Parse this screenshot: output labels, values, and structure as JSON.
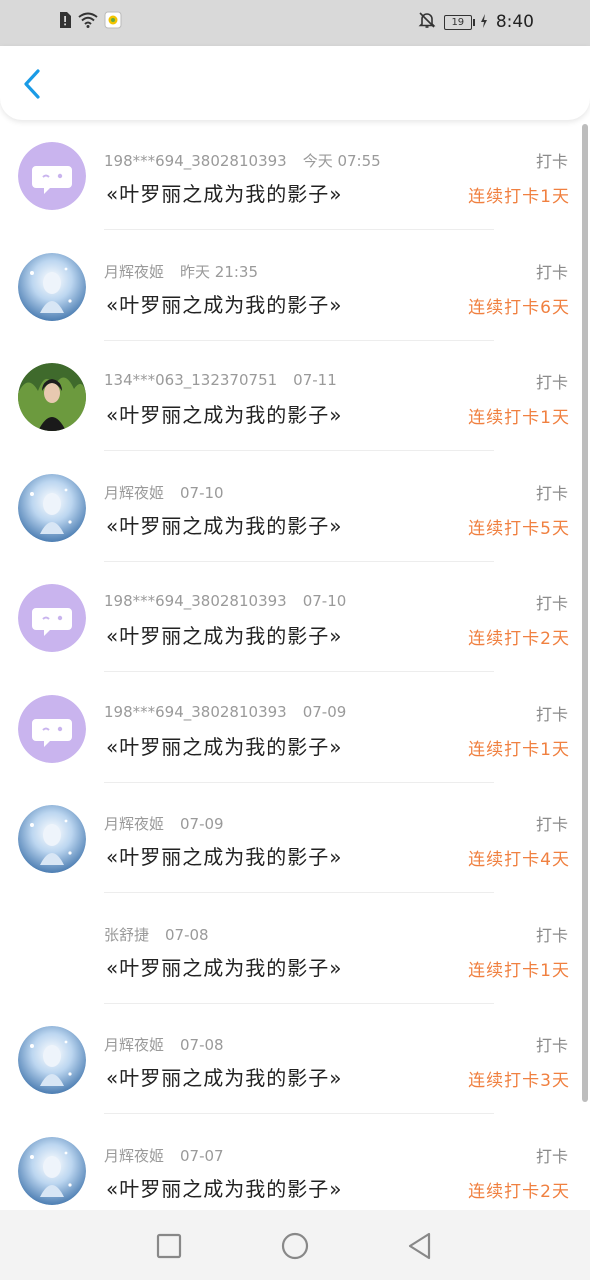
{
  "status_bar": {
    "time": "8:40",
    "battery_level": "19"
  },
  "icons": {
    "back": "chevron-left-icon",
    "nav_recent": "square-icon",
    "nav_home": "circle-icon",
    "nav_back": "triangle-back-icon"
  },
  "colors": {
    "accent_blue": "#1a9be6",
    "streak_orange": "#f08040",
    "avatar_purple": "#c9b4ee"
  },
  "list": [
    {
      "user": "198***694_3802810393",
      "date": "今天 07:55",
      "title": "«叶罗丽之成为我的影子»",
      "action": "打卡",
      "streak": "连续打卡1天",
      "avatar": "purple"
    },
    {
      "user": "月辉夜姬",
      "date": "昨天 21:35",
      "title": "«叶罗丽之成为我的影子»",
      "action": "打卡",
      "streak": "连续打卡6天",
      "avatar": "blue"
    },
    {
      "user": "134***063_132370751",
      "date": "07-11",
      "title": "«叶罗丽之成为我的影子»",
      "action": "打卡",
      "streak": "连续打卡1天",
      "avatar": "green"
    },
    {
      "user": "月辉夜姬",
      "date": "07-10",
      "title": "«叶罗丽之成为我的影子»",
      "action": "打卡",
      "streak": "连续打卡5天",
      "avatar": "blue"
    },
    {
      "user": "198***694_3802810393",
      "date": "07-10",
      "title": "«叶罗丽之成为我的影子»",
      "action": "打卡",
      "streak": "连续打卡2天",
      "avatar": "purple"
    },
    {
      "user": "198***694_3802810393",
      "date": "07-09",
      "title": "«叶罗丽之成为我的影子»",
      "action": "打卡",
      "streak": "连续打卡1天",
      "avatar": "purple"
    },
    {
      "user": "月辉夜姬",
      "date": "07-09",
      "title": "«叶罗丽之成为我的影子»",
      "action": "打卡",
      "streak": "连续打卡4天",
      "avatar": "blue"
    },
    {
      "user": "张舒捷",
      "date": "07-08",
      "title": "«叶罗丽之成为我的影子»",
      "action": "打卡",
      "streak": "连续打卡1天",
      "avatar": "none"
    },
    {
      "user": "月辉夜姬",
      "date": "07-08",
      "title": "«叶罗丽之成为我的影子»",
      "action": "打卡",
      "streak": "连续打卡3天",
      "avatar": "blue"
    },
    {
      "user": "月辉夜姬",
      "date": "07-07",
      "title": "«叶罗丽之成为我的影子»",
      "action": "打卡",
      "streak": "连续打卡2天",
      "avatar": "blue"
    }
  ]
}
